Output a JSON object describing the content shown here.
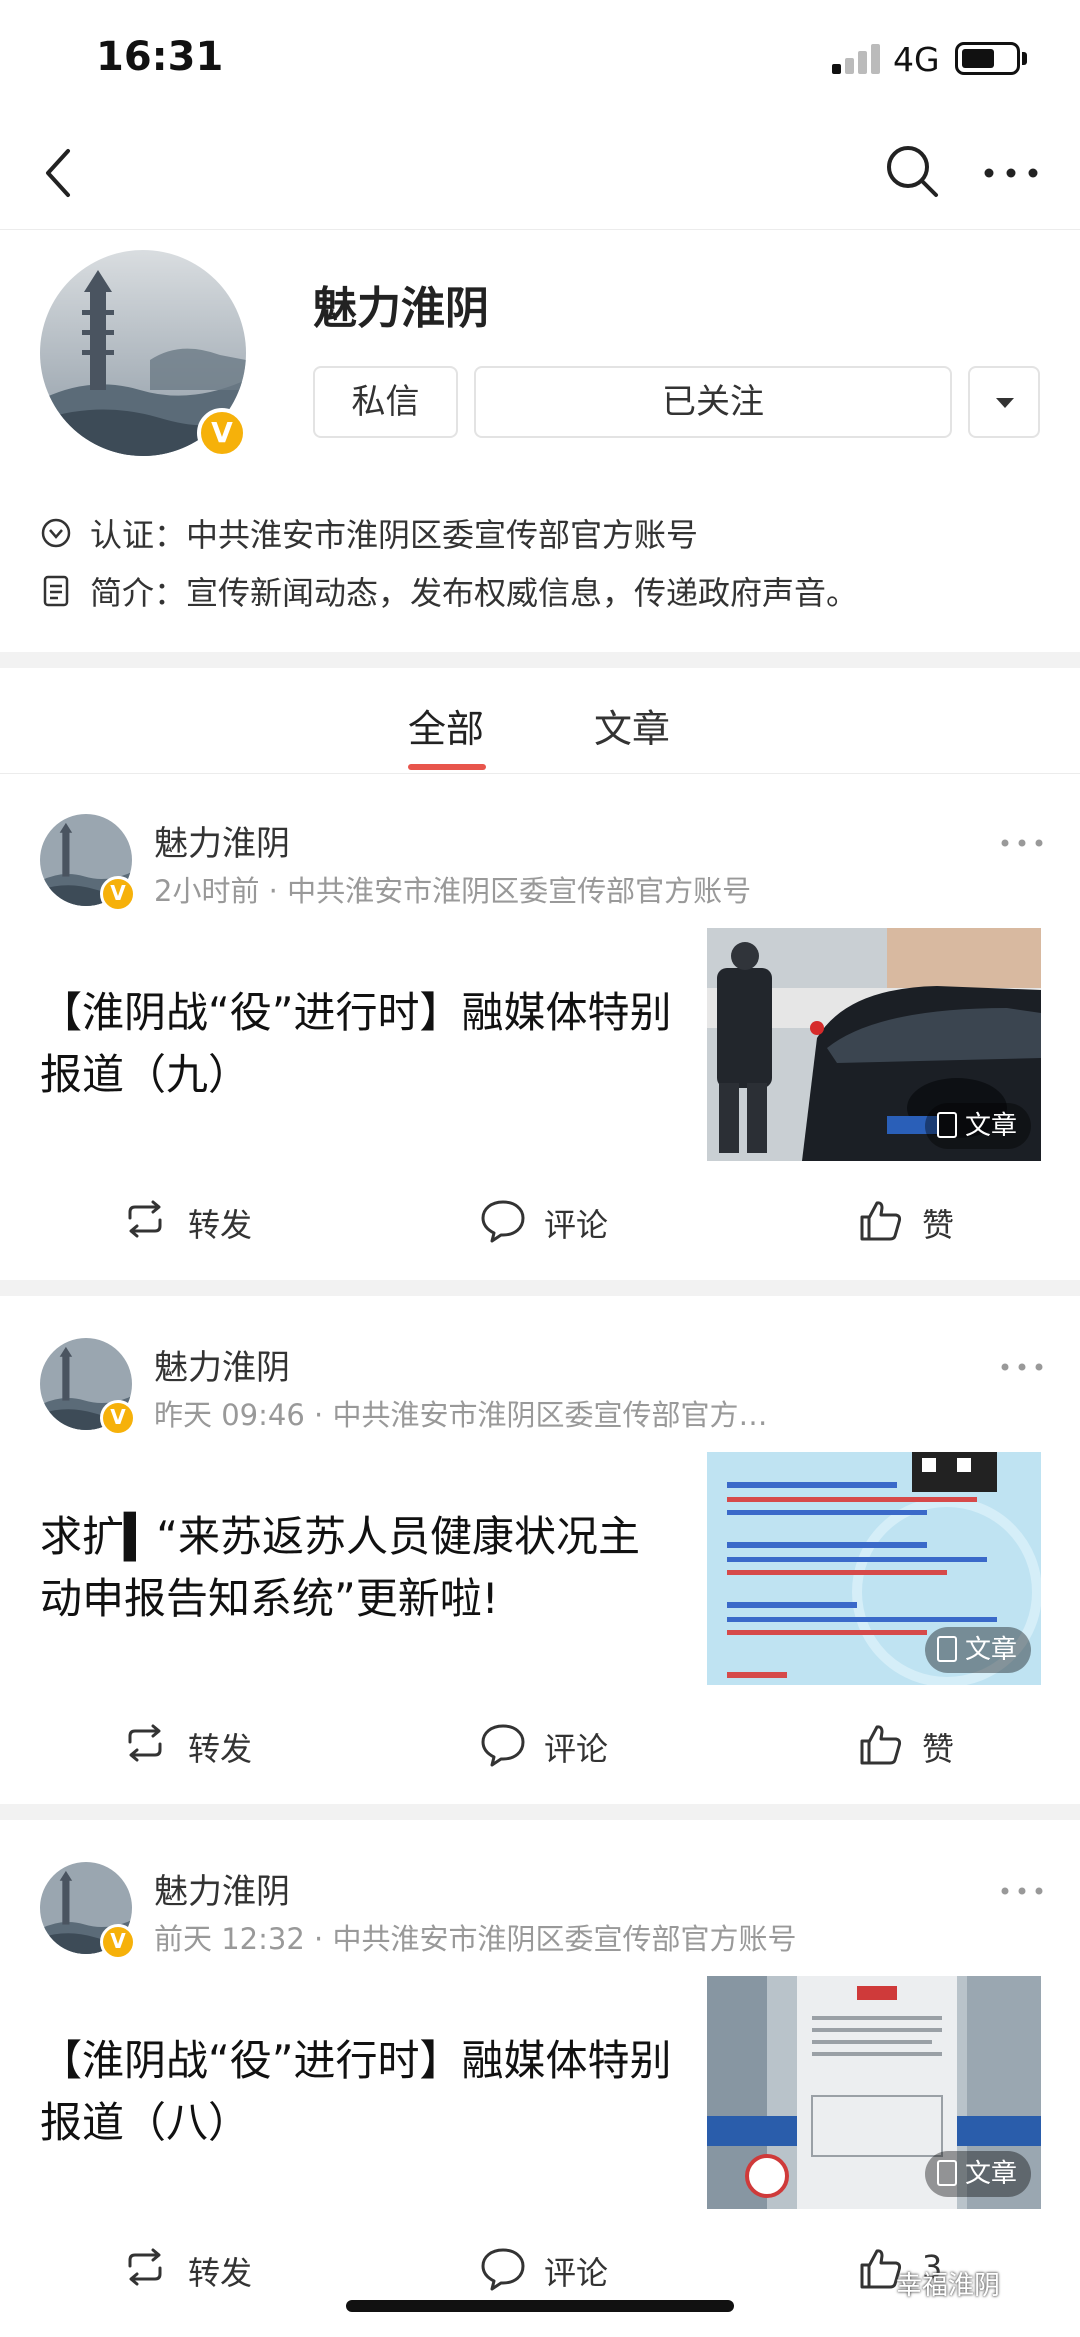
{
  "status_bar": {
    "time": "16:31",
    "network": "4G"
  },
  "profile": {
    "name": "魅力淮阴",
    "message_button": "私信",
    "follow_button": "已关注",
    "verify_label": "认证：",
    "verify_text": "中共淮安市淮阴区委宣传部官方账号",
    "intro_label": "简介：",
    "intro_text": "宣传新闻动态，发布权威信息，传递政府声音。"
  },
  "tabs": [
    {
      "label": "全部",
      "active": true
    },
    {
      "label": "文章",
      "active": false
    }
  ],
  "posts": [
    {
      "author": "魅力淮阴",
      "meta": "2小时前 · 中共淮安市淮阴区委宣传部官方账号",
      "title": "【淮阴战“役”进行时】融媒体特别报道（九）",
      "thumb_label": "文章",
      "repost": "转发",
      "comment": "评论",
      "like": "赞"
    },
    {
      "author": "魅力淮阴",
      "meta": "昨天 09:46 · 中共淮安市淮阴区委宣传部官方…",
      "title": "求扩▍“来苏返苏人员健康状况主动申报告知系统”更新啦!",
      "thumb_label": "文章",
      "repost": "转发",
      "comment": "评论",
      "like": "赞"
    },
    {
      "author": "魅力淮阴",
      "meta": "前天 12:32 · 中共淮安市淮阴区委宣传部官方账号",
      "title": "【淮阴战“役”进行时】融媒体特别报道（八）",
      "thumb_label": "文章",
      "repost": "转发",
      "comment": "评论",
      "like": "3"
    }
  ],
  "watermark": "幸福淮阴",
  "colors": {
    "accent": "#e8554c",
    "verified_badge": "#f6b10a",
    "meta_gray": "#999999"
  }
}
